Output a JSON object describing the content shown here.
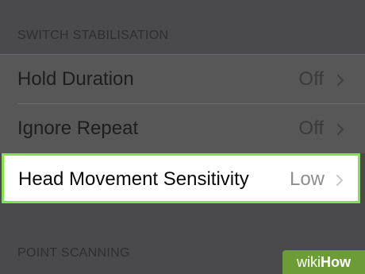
{
  "sections": [
    {
      "header": "SWITCH STABILISATION",
      "rows": [
        {
          "label": "Hold Duration",
          "value": "Off"
        },
        {
          "label": "Ignore Repeat",
          "value": "Off"
        },
        {
          "label": "Head Movement Sensitivity",
          "value": "Low",
          "highlighted": true
        }
      ]
    },
    {
      "header": "POINT SCANNING",
      "rows": []
    }
  ],
  "watermark": {
    "prefix": "wiki",
    "suffix": "How"
  },
  "colors": {
    "dim_background": "#4a4a4c",
    "highlight_border": "#7fe44a",
    "watermark_green": "#6d9c37"
  },
  "icons": {
    "disclosure": "chevron-right-icon"
  }
}
